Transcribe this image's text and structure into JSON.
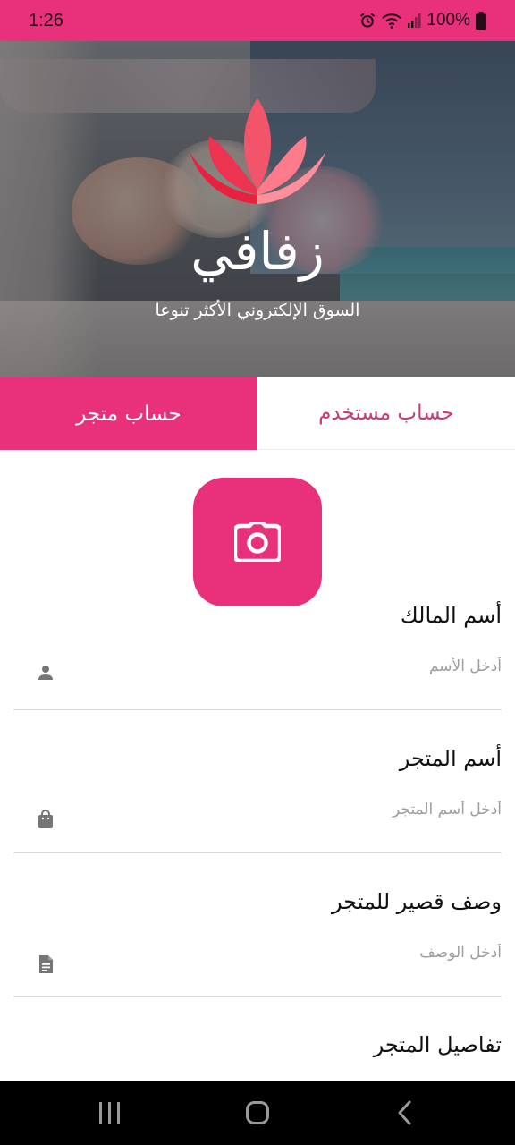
{
  "status_bar": {
    "time": "1:26",
    "battery": "100%",
    "icons": [
      "alarm-icon",
      "wifi-icon",
      "signal-icon",
      "battery-icon"
    ]
  },
  "hero": {
    "brand_name": "زفافي",
    "tagline": "السوق الإلكتروني الأكثر تنوعا",
    "logo_icon": "lotus-logo-icon"
  },
  "tabs": {
    "store": "حساب متجر",
    "user": "حساب مستخدم",
    "active": "store"
  },
  "camera": {
    "icon": "camera-icon"
  },
  "form": {
    "owner_name": {
      "label": "أسم المالك",
      "placeholder": "أدخل الأسم",
      "icon": "person-icon"
    },
    "store_name": {
      "label": "أسم المتجر",
      "placeholder": "أدخل أسم المتجر",
      "icon": "shopping-bag-icon"
    },
    "short_description": {
      "label": "وصف قصير للمتجر",
      "placeholder": "أدخل الوصف",
      "icon": "document-icon"
    },
    "store_details": {
      "label": "تفاصيل المتجر"
    }
  },
  "colors": {
    "accent": "#e8317a",
    "tab_inactive_text": "#c83a78",
    "label": "#111111",
    "placeholder": "#9e9e9e",
    "icon": "#757575"
  }
}
